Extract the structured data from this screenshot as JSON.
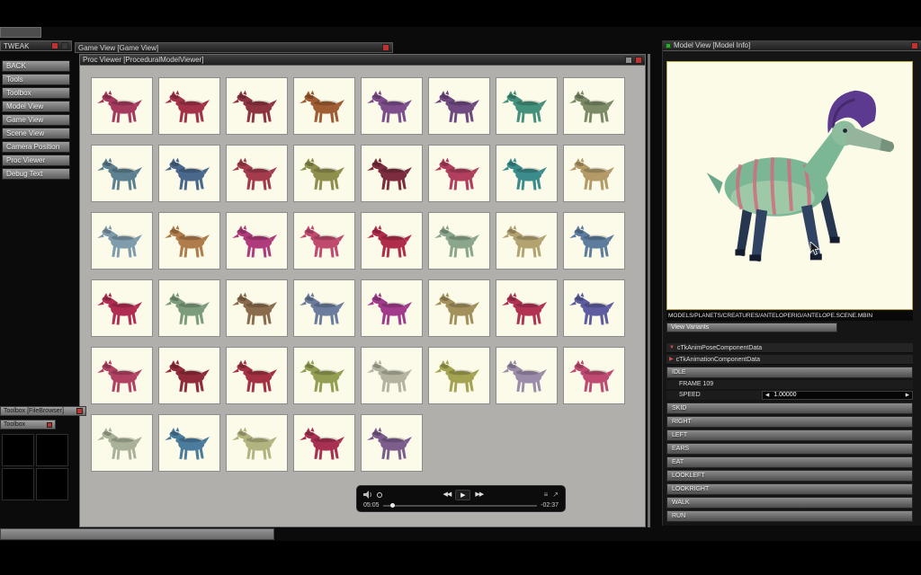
{
  "tweak": {
    "title": "TWEAK",
    "buttons": [
      "BACK",
      "Tools",
      "Toolbox",
      "Model View",
      "Game View",
      "Scene View",
      "Camera Position",
      "Proc Viewer",
      "Debug Text"
    ]
  },
  "game_view": {
    "title": "Game View  [Game View]"
  },
  "proc_viewer": {
    "title": "Proc Viewer  [ProceduralModelViewer]"
  },
  "grid": {
    "columns": 8,
    "creature_colors": [
      "#a63a5e",
      "#a33148",
      "#8e3340",
      "#a05c33",
      "#7d4d8c",
      "#6f4a80",
      "#43907c",
      "#7c8a66",
      "#5d8191",
      "#49688c",
      "#a43b4d",
      "#8f8f4d",
      "#7c2c3d",
      "#b13e5d",
      "#3b8c8c",
      "#b39a67",
      "#7e9cab",
      "#b07c4b",
      "#b03b7c",
      "#c04b6e",
      "#b02c4b",
      "#8aa68c",
      "#b3a371",
      "#5d7c9e",
      "#b02c52",
      "#7c9c7c",
      "#8a6b4b",
      "#6b7c9e",
      "#a23b8c",
      "#a3915c",
      "#b13253",
      "#5d5da0",
      "#b14263",
      "#912a3a",
      "#a33143",
      "#939e52",
      "#b3b3a0",
      "#a3a352",
      "#9c8cab",
      "#c04b72",
      "#a9b199",
      "#4b7c9e",
      "#b3b380",
      "#a83152",
      "#7c5d8c"
    ]
  },
  "player": {
    "elapsed": "05:05",
    "remaining": "-02:37",
    "progress_pct": 5
  },
  "model_view": {
    "title": "Model View  [Model Info]",
    "model_path": "MODELS/PLANETS/CREATURES/ANTELOPERIG/ANTELOPE.SCENE.MBIN",
    "view_variants_label": "View Variants",
    "components": [
      {
        "expanded": true,
        "label": "cTkAnimPoseComponentData"
      },
      {
        "expanded": false,
        "label": "cTkAnimationComponentData"
      }
    ],
    "rows": [
      {
        "type": "anim",
        "label": "IDLE"
      },
      {
        "type": "info",
        "label": "FRAME 109"
      },
      {
        "type": "speed",
        "label": "SPEED",
        "value": "1.00000"
      },
      {
        "type": "anim",
        "label": "SKID"
      },
      {
        "type": "anim",
        "label": "RIGHT"
      },
      {
        "type": "anim",
        "label": "LEFT"
      },
      {
        "type": "anim",
        "label": "EARS"
      },
      {
        "type": "anim",
        "label": "EAT"
      },
      {
        "type": "anim",
        "label": "LOOKLEFT"
      },
      {
        "type": "anim",
        "label": "LOOKRIGHT"
      },
      {
        "type": "anim",
        "label": "WALK"
      },
      {
        "type": "anim",
        "label": "RUN"
      }
    ]
  },
  "toolbox": {
    "title": "Toolbox  [FileBrowser]",
    "inner_title": "Toolbox",
    "thumb_count": 4
  },
  "icons": {
    "rewind": "◀◀",
    "play": "▶",
    "fast_forward": "▶▶",
    "settings": "≡",
    "share": "↗",
    "spinner_left": "◀",
    "spinner_right": "▶",
    "component_expanded": "▼",
    "component_collapsed": "▶"
  },
  "colors": {
    "accent_red": "#c23030",
    "viewport_bg": "#fcfbe7",
    "cell_bg": "#fcfbe9",
    "model_body": "#7cb795",
    "model_crest": "#5c3a8f",
    "model_stripes": "#cf6e80"
  }
}
